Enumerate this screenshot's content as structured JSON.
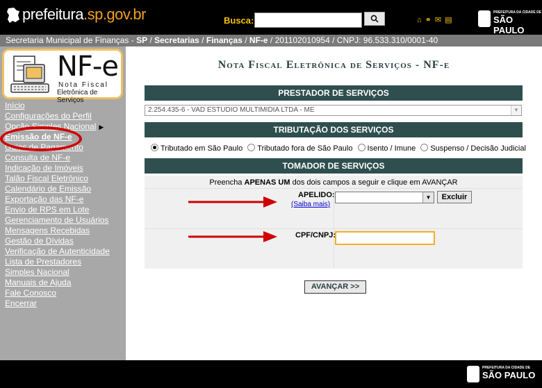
{
  "header": {
    "logo_text": "prefeitura",
    "logo_domain": ".sp.gov.br",
    "search_label": "Busca:",
    "search_value": "",
    "top_icons": [
      "home-icon",
      "sitemap-icon",
      "mail-icon",
      "print-icon"
    ],
    "brand_small": "PREFEITURA DA CIDADE DE",
    "brand_big": "SÃO PAULO"
  },
  "breadcrumb": {
    "part1": "Secretaria Municipal de Finanças - ",
    "sp": "SP",
    "sep1": " / ",
    "secretarias": "Secretarias",
    "sep2": " / ",
    "financas": "Finanças",
    "sep3": " / ",
    "nfe": "NF-e",
    "rest": " / 201102010954 / CNPJ: 96.533.310/0001-40"
  },
  "sidebar": {
    "logo_big": "NF-e",
    "logo_line1": "Nota Fiscal",
    "logo_line2": "Eletrônica de Serviços",
    "items": [
      {
        "label": "Início"
      },
      {
        "label": "Configurações do Perfil"
      },
      {
        "label": "Opção Simples Nacional"
      },
      {
        "label": "Emissão de NF-e"
      },
      {
        "label": "Guias de Pagamento"
      },
      {
        "label": "Consulta de NF-e"
      },
      {
        "label": "Indicação de Imóveis"
      },
      {
        "label": "Talão Fiscal Eletrônico"
      },
      {
        "label": "Calendário de Emissão"
      },
      {
        "label": "Exportação das NF-e"
      },
      {
        "label": "Envio de RPS em Lote"
      },
      {
        "label": "Gerenciamento de Usuários"
      },
      {
        "label": "Mensagens Recebidas"
      },
      {
        "label": "Gestão de Dívidas"
      },
      {
        "label": "Verificação de Autenticidade"
      },
      {
        "label": "Lista de Prestadores"
      },
      {
        "label": "Simples Nacional"
      },
      {
        "label": "Manuais de Ajuda"
      },
      {
        "label": "Fale Conosco"
      },
      {
        "label": "Encerrar"
      }
    ]
  },
  "main": {
    "title": "Nota Fiscal Eletrônica de Serviços - NF-e",
    "prestador_header": "PRESTADOR DE SERVIÇOS",
    "prestador_value": "2.254.435-6 - VAD ESTUDIO MULTIMIDIA LTDA - ME",
    "tributacao_header": "TRIBUTAÇÃO DOS SERVIÇOS",
    "tributacao_options": [
      {
        "label": "Tributado em São Paulo",
        "selected": true
      },
      {
        "label": "Tributado fora de São Paulo",
        "selected": false
      },
      {
        "label": "Isento / Imune",
        "selected": false
      },
      {
        "label": "Suspenso / Decisão Judicial",
        "selected": false
      }
    ],
    "tomador_header": "TOMADOR DE SERVIÇOS",
    "instr_pre": "Preencha ",
    "instr_bold": "APENAS UM",
    "instr_post": " dos dois campos a seguir e clique em AVANÇAR",
    "apelido_label": "APELIDO:",
    "saiba_mais": "(Saiba mais)",
    "apelido_value": "",
    "excluir_label": "Excluir",
    "cpf_label": "CPF/CNPJ:",
    "cpf_value": "",
    "avancar_label": "AVANÇAR >>"
  },
  "footer": {
    "brand_small": "PREFEITURA DA CIDADE DE",
    "brand_big": "SÃO PAULO"
  },
  "colors": {
    "header_bar": "#2f4f4f",
    "sidebar": "#a8a8a8",
    "breadcrumb": "#7a7a7a",
    "highlight_red": "#d00000",
    "accent_yellow": "#f5c000"
  }
}
